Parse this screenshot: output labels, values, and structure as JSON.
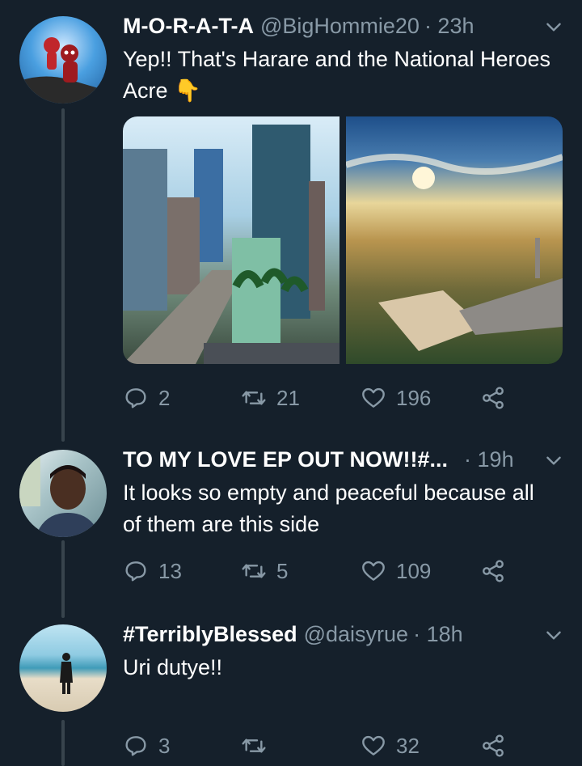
{
  "tweets": [
    {
      "name": "M-O-R-A-T-A",
      "handle": "@BigHommie20",
      "time": "· 23h",
      "text": "Yep!! That's Harare and the National Heroes Acre 👇",
      "replies": "2",
      "retweets": "21",
      "likes": "196",
      "avatar_icon": "deadpool-spiderman-avatar",
      "media": [
        "harare-city-photo",
        "national-heroes-acre-photo"
      ]
    },
    {
      "name": "TO MY LOVE EP OUT NOW!!#...",
      "handle": "",
      "time": "· 19h",
      "text": "It looks so empty and peaceful because all of them are this side",
      "replies": "13",
      "retweets": "5",
      "likes": "109",
      "avatar_icon": "man-portrait-avatar"
    },
    {
      "name": "#TerriblyBlessed",
      "handle": "@daisyrue",
      "time": "· 18h",
      "text": "Uri dutye!!",
      "replies": "3",
      "retweets": "",
      "likes": "32",
      "avatar_icon": "beach-person-avatar"
    }
  ],
  "colors": {
    "background": "#15202b",
    "secondary_text": "#8899a6",
    "thread_line": "#38444d"
  }
}
